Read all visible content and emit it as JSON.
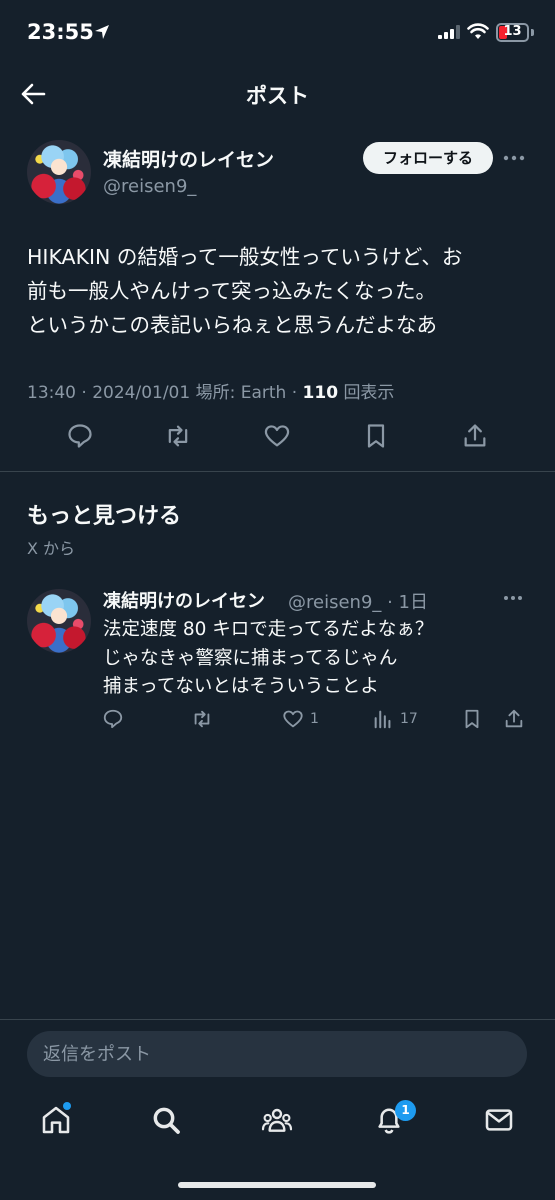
{
  "status_bar": {
    "time": "23:55",
    "battery": "13"
  },
  "header": {
    "title": "ポスト"
  },
  "post": {
    "author_name": "凍結明けのレイセン",
    "author_handle": "@reisen9_",
    "follow_label": "フォローする",
    "text_lines": [
      "HIKAKIN の結婚って一般女性っていうけど、お",
      "前も一般人やんけって突っ込みたくなった。",
      "というかこの表記いらねぇと思うんだよなあ"
    ],
    "meta_prefix": "13:40 · 2024/01/01 場所: Earth · ",
    "views_count": "110",
    "views_label": "回表示"
  },
  "discover": {
    "title": "もっと見つける",
    "subtitle": "X から"
  },
  "recommended_post": {
    "author_name": "凍結明けのレイセン",
    "author_handle": "@reisen9_ · 1日",
    "text_lines": [
      "法定速度 80 キロで走ってるだよなぁ？",
      "じゃなきゃ警察に捕まってるじゃん",
      "捕まってないとはそういうことよ"
    ],
    "like_count": "1",
    "view_count": "17"
  },
  "reply": {
    "placeholder": "返信をポスト"
  },
  "bottom_nav": {
    "notification_badge": "1",
    "items": [
      "home-icon",
      "search-icon",
      "communities-icon",
      "bell-icon",
      "mail-icon"
    ]
  },
  "colors": {
    "background": "#15202b",
    "accent": "#1d9bf0",
    "secondary_text": "#8b98a5",
    "divider": "#38444d",
    "battery_low": "#f4212e"
  }
}
